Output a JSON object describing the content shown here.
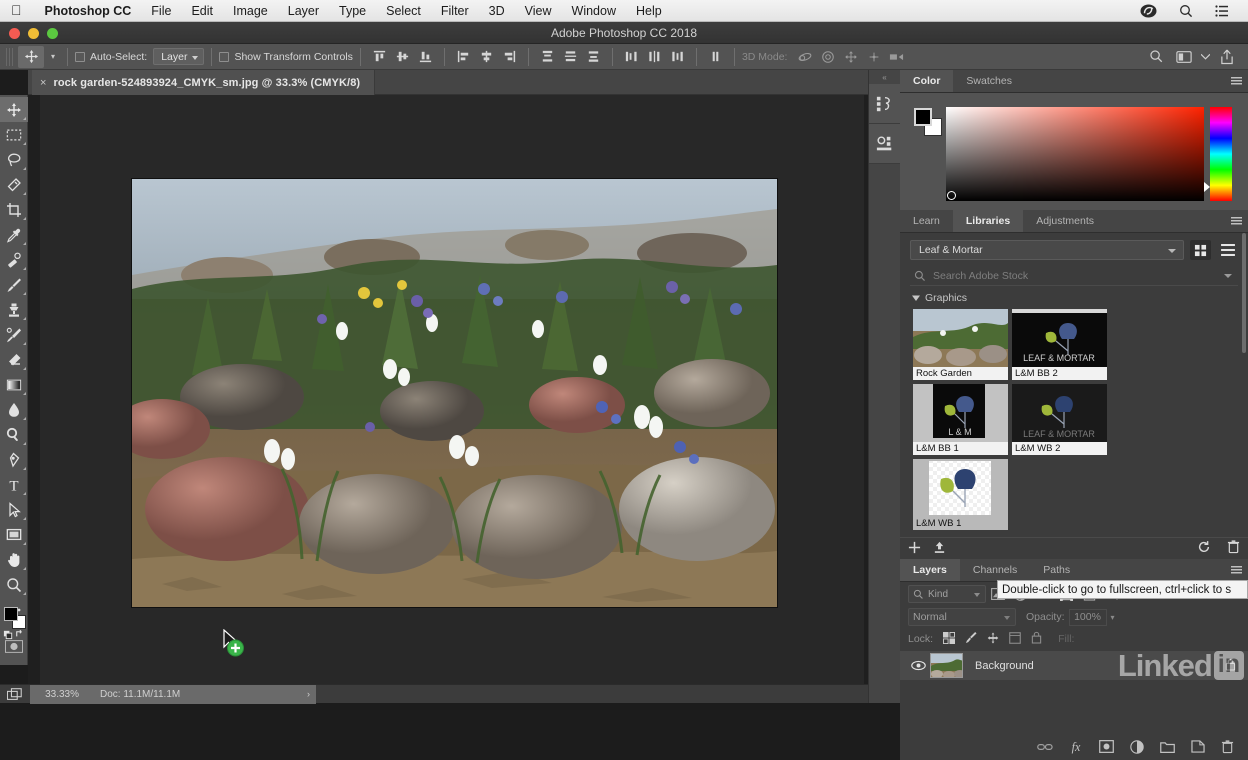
{
  "macmenu": {
    "apple_icon": "apple-icon",
    "items": [
      "Photoshop CC",
      "File",
      "Edit",
      "Image",
      "Layer",
      "Type",
      "Select",
      "Filter",
      "3D",
      "View",
      "Window",
      "Help"
    ],
    "right_icons": [
      "creative-cloud-icon",
      "spotlight-search-icon",
      "control-center-icon"
    ]
  },
  "titlebar": {
    "title": "Adobe Photoshop CC 2018",
    "traffic": [
      "close",
      "minimize",
      "zoom"
    ]
  },
  "optionsbar": {
    "tool_icon": "move-tool-icon",
    "auto_select_label": "Auto-Select:",
    "auto_select_value": "Layer",
    "show_transform_label": "Show Transform Controls",
    "align_icons": [
      "align-top-edges-icon",
      "align-vertical-centers-icon",
      "align-bottom-edges-icon",
      "align-left-edges-icon",
      "align-horizontal-centers-icon",
      "align-right-edges-icon",
      "distribute-top-edges-icon",
      "distribute-vertical-centers-icon",
      "distribute-bottom-edges-icon",
      "distribute-left-edges-icon",
      "distribute-horizontal-centers-icon",
      "distribute-right-edges-icon"
    ],
    "more_icon": "align-more-icon",
    "mode_label": "3D Mode:",
    "mode_icons": [
      "orbit-3d-icon",
      "roll-3d-icon",
      "pan-3d-icon",
      "slide-3d-icon",
      "scale-3d-icon"
    ],
    "right_icons": [
      "search-icon",
      "workspace-icon",
      "workspace-chevron-icon",
      "share-icon"
    ]
  },
  "toolbar": {
    "tools": [
      {
        "name": "move-tool",
        "selected": true
      },
      {
        "name": "rectangular-marquee-tool",
        "selected": false
      },
      {
        "name": "lasso-tool",
        "selected": false
      },
      {
        "name": "quick-selection-tool",
        "selected": false
      },
      {
        "name": "crop-tool",
        "selected": false
      },
      {
        "name": "eyedropper-tool",
        "selected": false
      },
      {
        "name": "spot-healing-brush-tool",
        "selected": false
      },
      {
        "name": "brush-tool",
        "selected": false
      },
      {
        "name": "clone-stamp-tool",
        "selected": false
      },
      {
        "name": "history-brush-tool",
        "selected": false
      },
      {
        "name": "eraser-tool",
        "selected": false
      },
      {
        "name": "gradient-tool",
        "selected": false
      },
      {
        "name": "blur-tool",
        "selected": false
      },
      {
        "name": "dodge-tool",
        "selected": false
      },
      {
        "name": "pen-tool",
        "selected": false
      },
      {
        "name": "type-tool",
        "selected": false
      },
      {
        "name": "path-selection-tool",
        "selected": false
      },
      {
        "name": "rectangle-tool",
        "selected": false
      },
      {
        "name": "hand-tool",
        "selected": false
      },
      {
        "name": "zoom-tool",
        "selected": false
      },
      {
        "name": "edit-toolbar",
        "selected": false
      }
    ],
    "foreground_color": "#000000",
    "background_color": "#ffffff"
  },
  "document": {
    "tab_title": "rock garden-524893924_CMYK_sm.jpg @ 33.3% (CMYK/8)",
    "close_glyph": "×"
  },
  "statusbar": {
    "zoom": "33.33%",
    "doc": "Doc: 11.1M/11.1M",
    "arrow": "›",
    "screenmode_icon": "screen-mode-icon"
  },
  "dockstrip": {
    "collapse_glyph": "«",
    "buttons": [
      "history-panel-icon",
      "properties-panel-icon"
    ]
  },
  "color_panel": {
    "tabs": [
      {
        "label": "Color",
        "active": true
      },
      {
        "label": "Swatches",
        "active": false
      }
    ],
    "menu_icon": "panel-menu-icon",
    "foreground": "#000000",
    "background": "#ffffff"
  },
  "libraries_panel": {
    "tabs": [
      {
        "label": "Learn",
        "active": false
      },
      {
        "label": "Libraries",
        "active": true
      },
      {
        "label": "Adjustments",
        "active": false
      }
    ],
    "menu_icon": "panel-menu-icon",
    "library_name": "Leaf & Mortar",
    "view_grid_icon": "grid-view-icon",
    "view_list_icon": "list-view-icon",
    "search_placeholder": "Search Adobe Stock",
    "search_icon": "search-icon",
    "group_label": "Graphics",
    "assets": [
      {
        "label": "Rock Garden",
        "kind": "photo",
        "selected": false
      },
      {
        "label": "L&M BB 2",
        "kind": "logo-dark",
        "selected": false
      },
      {
        "label": "L&M BB 1",
        "kind": "logo-dark-narrow",
        "selected": false
      },
      {
        "label": "L&M WB 2",
        "kind": "logo-transparent",
        "selected": false
      },
      {
        "label": "L&M WB 1",
        "kind": "logo-light",
        "selected": true
      }
    ],
    "footer_icons": [
      "add-content-icon",
      "upload-icon",
      "sync-icon",
      "delete-icon"
    ]
  },
  "layers_panel": {
    "tabs": [
      {
        "label": "Layers",
        "active": true
      },
      {
        "label": "Channels",
        "active": false
      },
      {
        "label": "Paths",
        "active": false
      }
    ],
    "menu_icon": "panel-menu-icon",
    "filter_label": "Kind",
    "filter_icons": [
      "filter-pixel-icon",
      "filter-adjustment-icon",
      "filter-type-icon",
      "filter-shape-icon",
      "filter-smart-object-icon"
    ],
    "filter_toggle_icon": "filter-toggle-icon",
    "blend_mode": "Normal",
    "opacity_label": "Opacity:",
    "opacity_value": "100%",
    "lock_label": "Lock:",
    "lock_icons": [
      "lock-transparent-icon",
      "lock-image-icon",
      "lock-position-icon",
      "lock-artboard-icon",
      "lock-all-icon"
    ],
    "fill_label": "Fill:",
    "layers": [
      {
        "name": "Background",
        "visible": true,
        "locked": true,
        "lock_icon": "lock-icon",
        "eye_icon": "eye-icon"
      }
    ],
    "footer_icons": [
      "link-layers-icon",
      "layer-style-fx-icon",
      "layer-mask-icon",
      "adjustment-layer-icon",
      "new-group-icon",
      "new-layer-icon",
      "delete-layer-icon"
    ]
  },
  "tooltip": {
    "text": "Double-click to go to fullscreen, ctrl+click to s"
  },
  "cursor": {
    "name": "move-drag-cursor",
    "badge": "+"
  },
  "watermark": {
    "text": "Linked",
    "badge": "in"
  }
}
